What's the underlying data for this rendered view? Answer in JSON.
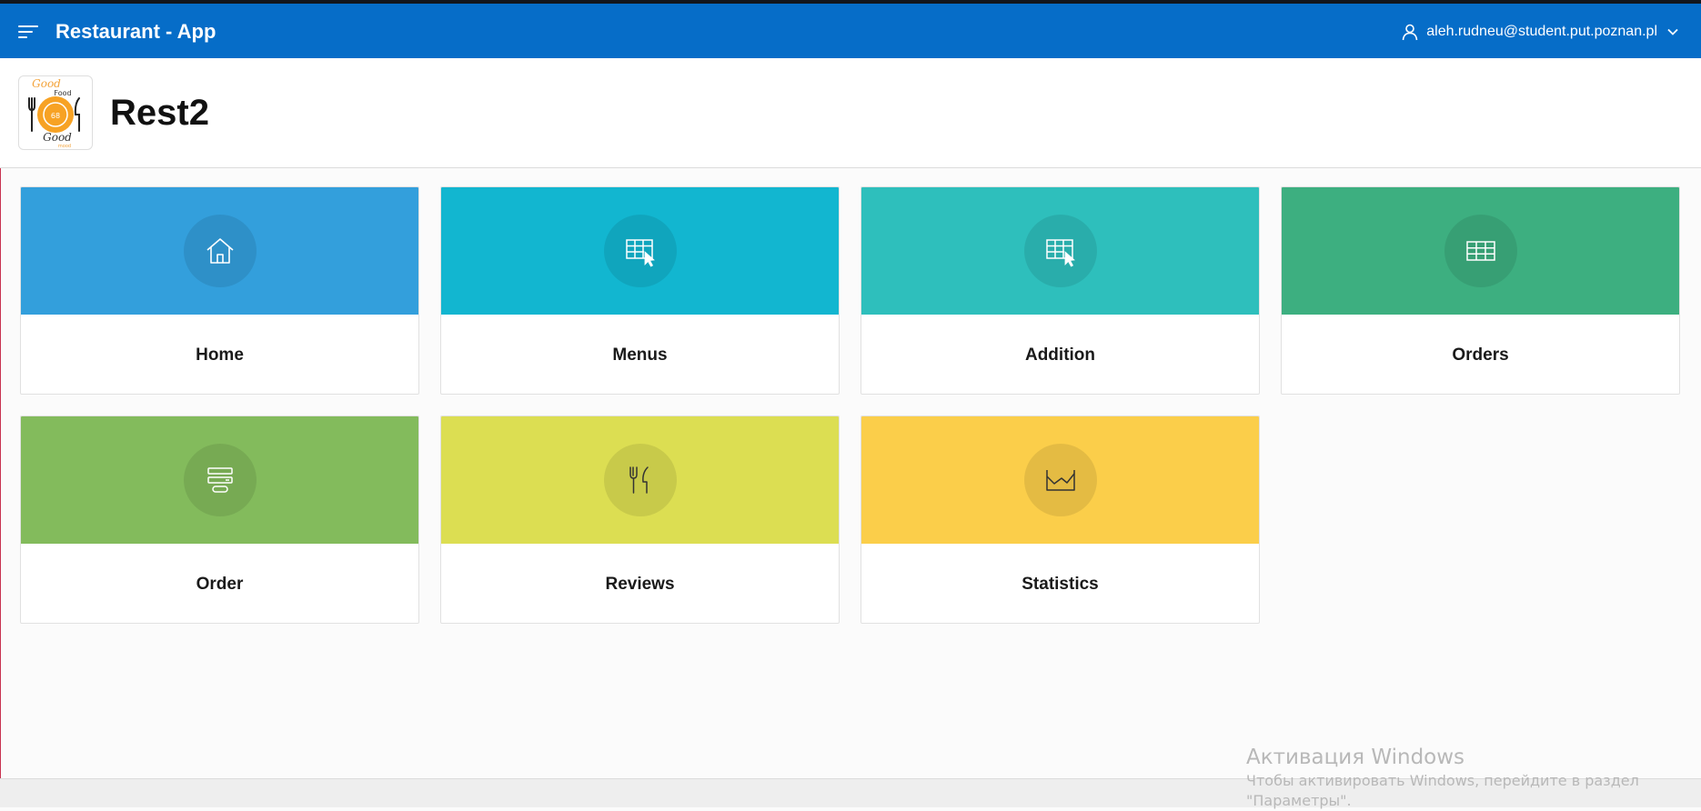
{
  "header": {
    "app_title": "Restaurant - App",
    "user_email": "aleh.rudneu@student.put.poznan.pl",
    "background_color": "#066dc8",
    "icons": {
      "menu": "hamburger-menu-icon",
      "user": "user-icon",
      "dropdown": "chevron-down-icon"
    }
  },
  "page": {
    "title": "Rest2",
    "logo": {
      "lines": [
        "Good",
        "Food",
        "Good",
        "mood"
      ],
      "icon": "restaurant-logo"
    }
  },
  "cards": [
    {
      "label": "Home",
      "color": "#339fdc",
      "icon": "home-icon"
    },
    {
      "label": "Menus",
      "color": "#12b6d0",
      "icon": "table-pointer-icon"
    },
    {
      "label": "Addition",
      "color": "#2ebfbc",
      "icon": "table-pointer-icon"
    },
    {
      "label": "Orders",
      "color": "#3daf80",
      "icon": "table-icon"
    },
    {
      "label": "Order",
      "color": "#83bb5c",
      "icon": "form-icon"
    },
    {
      "label": "Reviews",
      "color": "#dcde52",
      "icon": "fork-knife-icon"
    },
    {
      "label": "Statistics",
      "color": "#fbce4a",
      "icon": "area-chart-icon"
    }
  ],
  "os_watermark": {
    "title": "Активация Windows",
    "text_line_1": "Чтобы активировать Windows, перейдите в раздел",
    "text_line_2": "\"Параметры\"."
  }
}
